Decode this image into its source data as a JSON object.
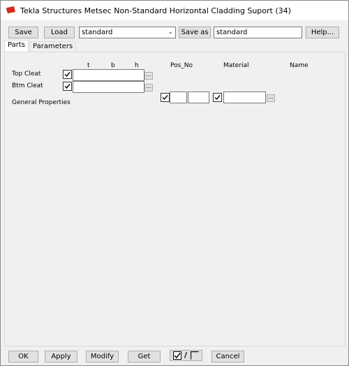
{
  "window": {
    "title": "Tekla Structures  Metsec Non-Standard Horizontal Cladding Suport (34)"
  },
  "toolbar": {
    "save_label": "Save",
    "load_label": "Load",
    "preset_value": "standard",
    "save_as_label": "Save as",
    "save_as_value": "standard",
    "help_label": "Help..."
  },
  "tabs": [
    {
      "label": "Parts",
      "active": true
    },
    {
      "label": "Parameters",
      "active": false
    }
  ],
  "parts": {
    "col_t": "t",
    "col_b": "b",
    "col_h": "h",
    "col_pos_no": "Pos_No",
    "col_material": "Material",
    "col_name": "Name",
    "top_cleat_label": "Top Cleat",
    "btm_cleat_label": "Btm Cleat",
    "general_properties_label": "General Properties",
    "browse_label": "..."
  },
  "footer": {
    "ok_label": "OK",
    "apply_label": "Apply",
    "modify_label": "Modify",
    "get_label": "Get",
    "toggle_separator": "/",
    "cancel_label": "Cancel"
  }
}
